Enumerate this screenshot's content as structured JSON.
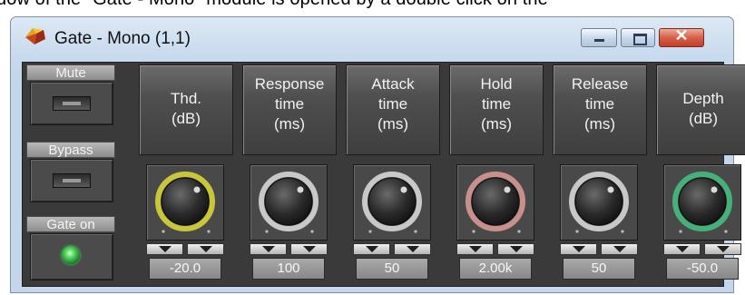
{
  "caption": "dow of the \"Gate - Mono\" module is opened by a double click on the",
  "window": {
    "title": "Gate - Mono (1,1)",
    "icon": "app-logo-icon"
  },
  "buttons": {
    "mute": "Mute",
    "bypass": "Bypass",
    "gate_on": "Gate on"
  },
  "channels": [
    {
      "key": "thd",
      "lines": [
        "Thd.",
        "(dB)"
      ],
      "value": "-20.0",
      "ring": "#c9c63a"
    },
    {
      "key": "response",
      "lines": [
        "Response",
        "time",
        "(ms)"
      ],
      "value": "100",
      "ring": "#c8c8c8"
    },
    {
      "key": "attack",
      "lines": [
        "Attack",
        "time",
        "(ms)"
      ],
      "value": "50",
      "ring": "#c8c8c8"
    },
    {
      "key": "hold",
      "lines": [
        "Hold",
        "time",
        "(ms)"
      ],
      "value": "2.00k",
      "ring": "#c88f8b"
    },
    {
      "key": "release",
      "lines": [
        "Release",
        "time",
        "(ms)"
      ],
      "value": "50",
      "ring": "#c8c8c8"
    },
    {
      "key": "depth",
      "lines": [
        "Depth",
        "(dB)"
      ],
      "value": "-50.0",
      "ring": "#44b07a"
    }
  ],
  "colors": {
    "gate_led": "#55d85f",
    "close_button": "#d5604a"
  }
}
